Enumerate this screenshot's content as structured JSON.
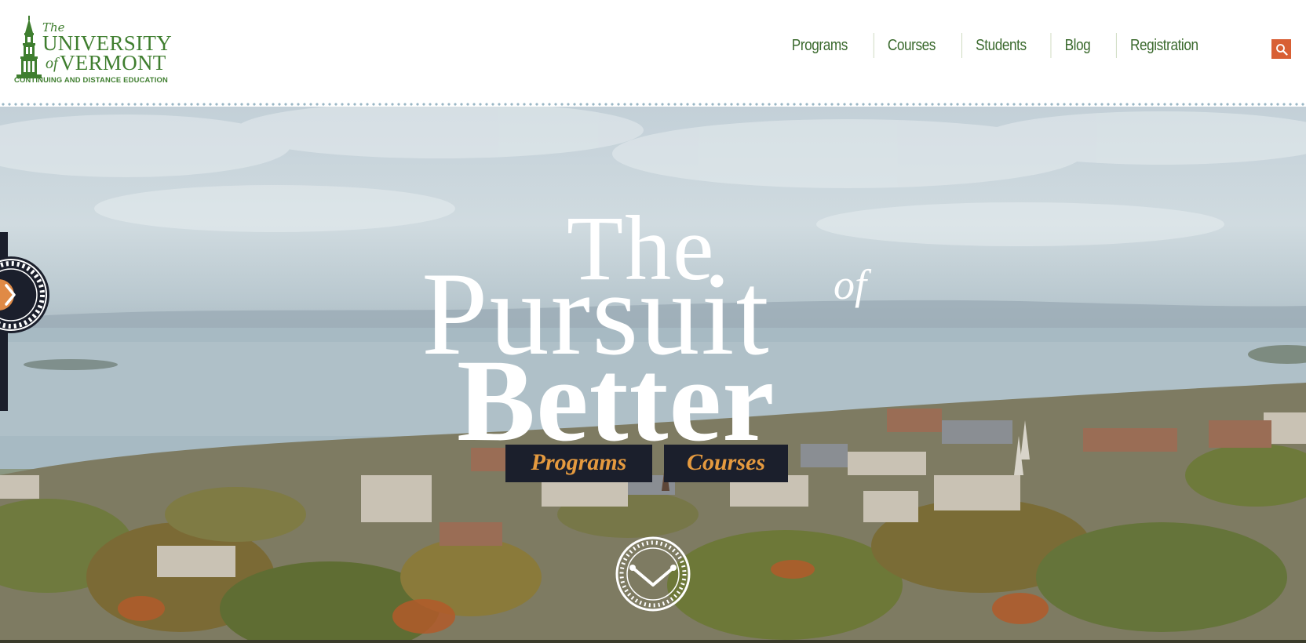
{
  "logo": {
    "the": "The",
    "university": "UNIVERSITY",
    "of": "of",
    "vermont": "VERMONT",
    "subtitle": "CONTINUING AND DISTANCE EDUCATION",
    "color": "#3f7e2f"
  },
  "nav": {
    "items": [
      {
        "label": "Programs"
      },
      {
        "label": "Courses"
      },
      {
        "label": "Students"
      },
      {
        "label": "Blog"
      },
      {
        "label": "Registration"
      }
    ],
    "search_icon": "search-icon",
    "search_color": "#d85f34"
  },
  "hero": {
    "headline": {
      "line1": "The",
      "line2": "Pursuit",
      "line2_suffix": "of",
      "line3": "Better"
    },
    "buttons": {
      "programs": "Programs",
      "courses": "Courses"
    },
    "button_bg": "#1b1f2c",
    "button_text_color": "#e59a3f",
    "side_badge_icon": "chevron-right-icon",
    "scroll_badge_icon": "chevron-down-icon"
  }
}
